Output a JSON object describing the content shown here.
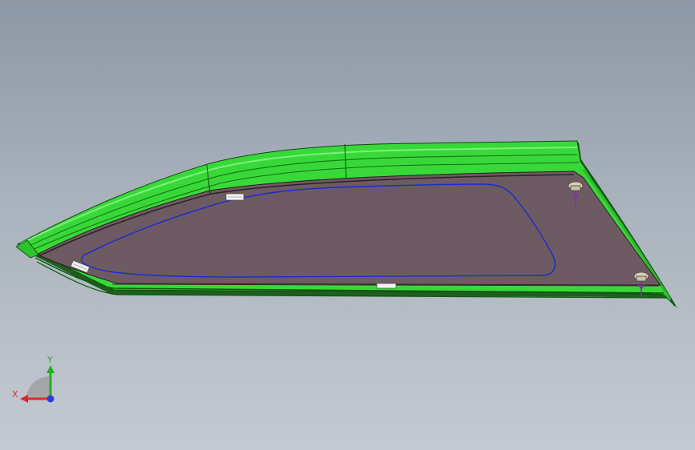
{
  "axes": {
    "x_label": "X",
    "y_label": "Y",
    "x_color": "#e02828",
    "y_color": "#22b022",
    "z_color": "#2a3cd8"
  },
  "model": {
    "trim_color": "#3adc3a",
    "trim_dark": "#1c7a1c",
    "glass_color": "#6e5a62",
    "contour_color": "#1a2ed0",
    "clip_color": "#8a2bb8"
  }
}
